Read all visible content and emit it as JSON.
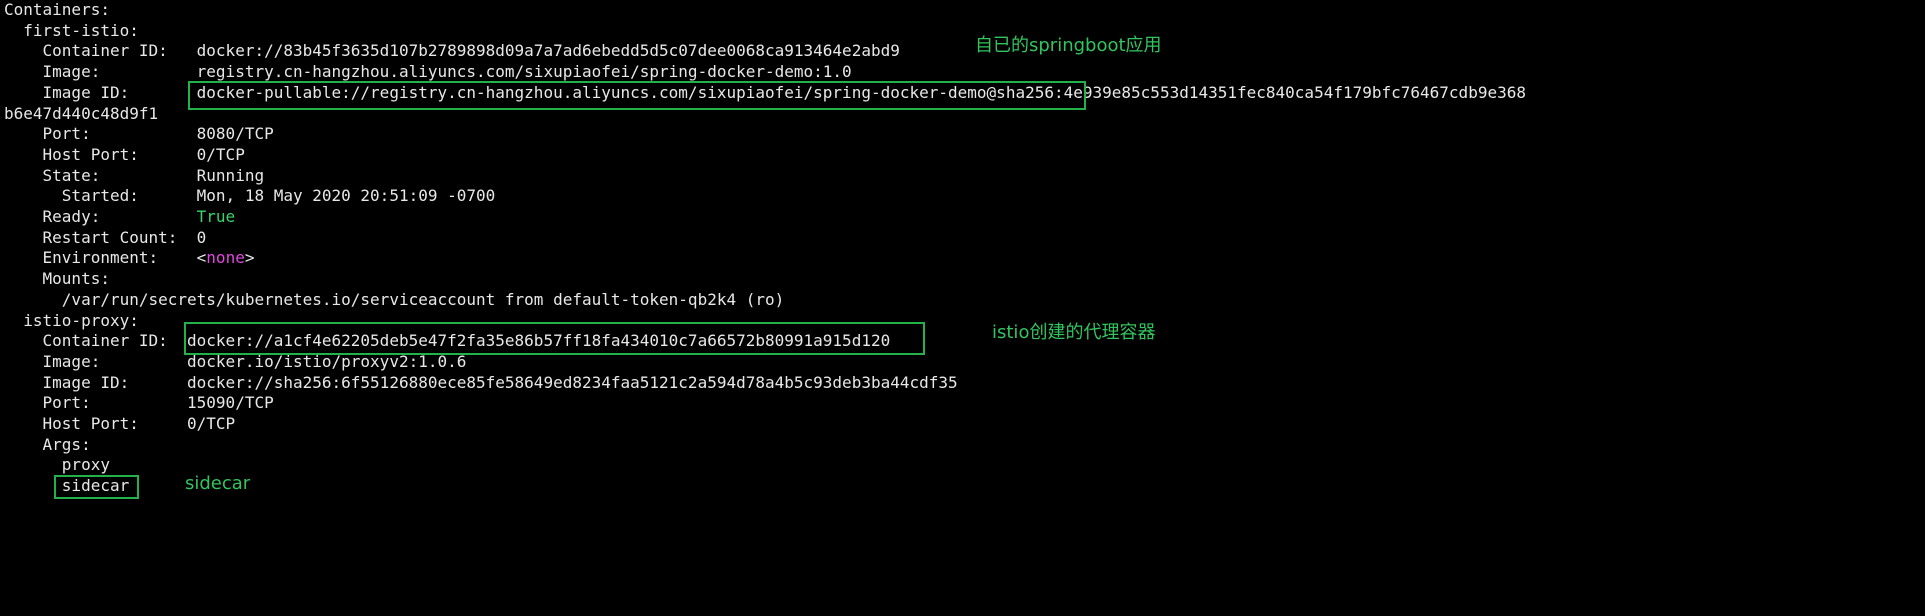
{
  "terminal": {
    "lines": [
      "Containers:",
      "  first-istio:",
      "    Container ID:   docker://83b45f3635d107b2789898d09a7a7ad6ebedd5d5c07dee0068ca913464e2abd9",
      "    Image:          registry.cn-hangzhou.aliyuncs.com/sixupiaofei/spring-docker-demo:1.0",
      "    Image ID:       docker-pullable://registry.cn-hangzhou.aliyuncs.com/sixupiaofei/spring-docker-demo@sha256:4e939e85c553d14351fec840ca54f179bfc76467cdb9e368",
      "b6e47d440c48d9f1",
      "    Port:           8080/TCP",
      "    Host Port:      0/TCP",
      "    State:          Running",
      "      Started:      Mon, 18 May 2020 20:51:09 -0700",
      "    Ready:          ",
      "    Restart Count:  0",
      "    Environment:    ",
      "    Mounts:",
      "      /var/run/secrets/kubernetes.io/serviceaccount from default-token-qb2k4 (ro)",
      "  istio-proxy:",
      "    Container ID:  docker://a1cf4e62205deb5e47f2fa35e86b57ff18fa434010c7a66572b80991a915d120",
      "    Image:         docker.io/istio/proxyv2:1.0.6",
      "    Image ID:      docker://sha256:6f55126880ece85fe58649ed8234faa5121c2a594d78a4b5c93deb3ba44cdf35",
      "    Port:          15090/TCP",
      "    Host Port:     0/TCP",
      "    Args:",
      "      proxy",
      "      sidecar"
    ],
    "ready_value": "True",
    "env_open": "<",
    "env_value": "none",
    "env_close": ">"
  },
  "annotations": {
    "springboot_note": "自已的springboot应用",
    "istio_note": "istio创建的代理容器",
    "sidecar_note": "sidecar"
  },
  "colors": {
    "background": "#000000",
    "text": "#e8e8e8",
    "ready_green": "#3bd26b",
    "none_magenta": "#e048e0",
    "annotation_green": "#32c45e",
    "box_green": "#23b24a"
  }
}
